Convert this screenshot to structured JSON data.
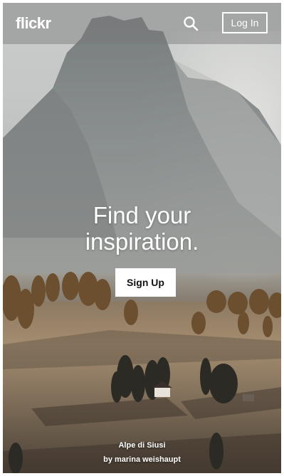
{
  "header": {
    "logo_text": "flickr",
    "search_icon": "search-icon",
    "login_label": "Log In"
  },
  "hero": {
    "title_line1": "Find your",
    "title_line2": "inspiration.",
    "signup_label": "Sign Up"
  },
  "photo_credit": {
    "title": "Alpe di Siusi",
    "author": "by marina weishaupt"
  }
}
